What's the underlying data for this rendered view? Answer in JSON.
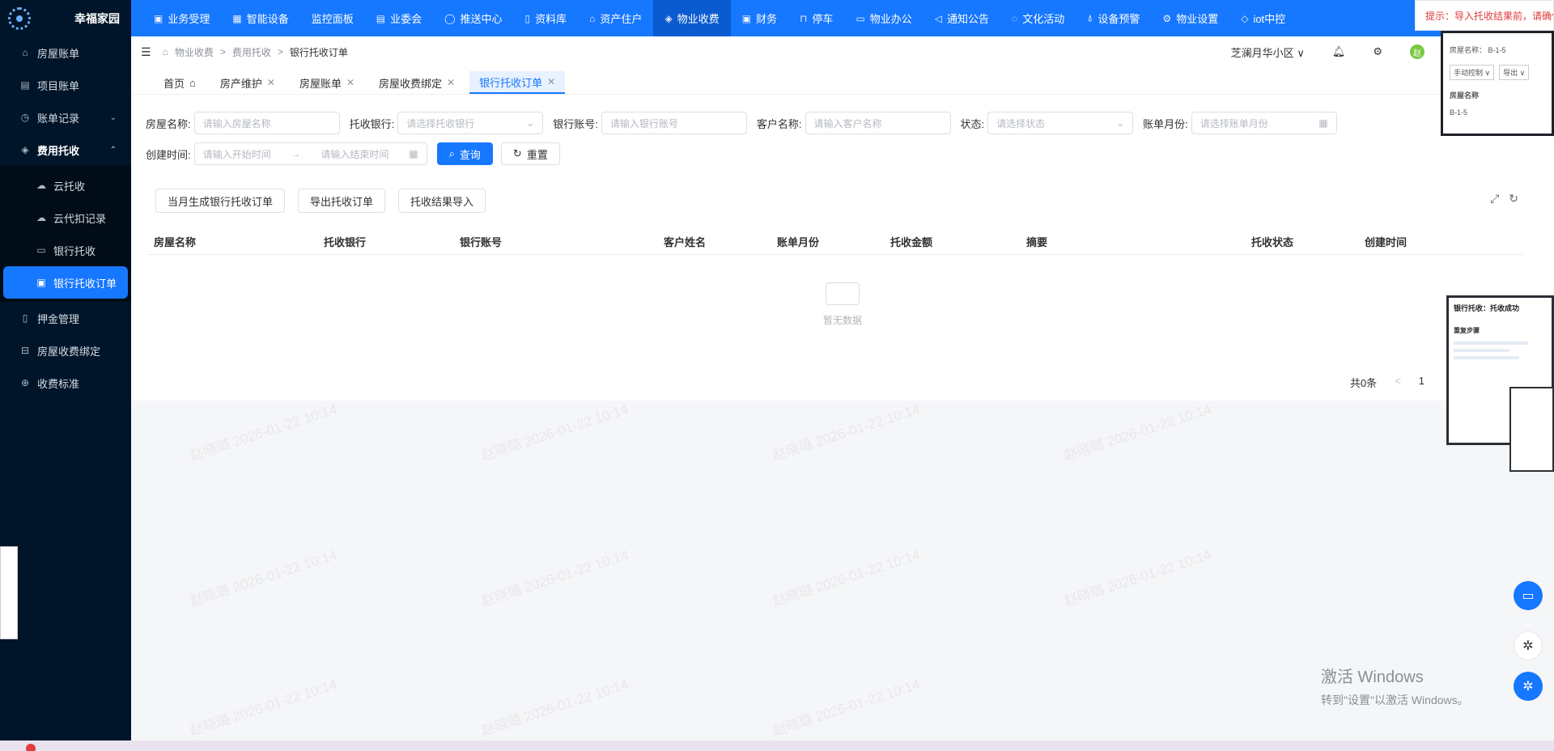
{
  "app": {
    "title": "幸福家园"
  },
  "sidebar": {
    "items": [
      {
        "label": "房屋账单",
        "icon": "home-icon"
      },
      {
        "label": "项目账单",
        "icon": "list-icon"
      },
      {
        "label": "账单记录",
        "icon": "clock-icon",
        "arrow": "⌄"
      },
      {
        "label": "费用托收",
        "icon": "shield-icon",
        "arrow": "⌃"
      }
    ],
    "sub_items": [
      {
        "label": "云托收"
      },
      {
        "label": "云代扣记录"
      },
      {
        "label": "银行托收"
      },
      {
        "label": "银行托收订单"
      }
    ],
    "more_items": [
      {
        "label": "押金管理"
      },
      {
        "label": "房屋收费绑定"
      },
      {
        "label": "收费标准"
      }
    ]
  },
  "topnav": {
    "items": [
      {
        "label": "业务受理"
      },
      {
        "label": "智能设备"
      },
      {
        "label": "监控面板"
      },
      {
        "label": "业委会"
      },
      {
        "label": "推送中心"
      },
      {
        "label": "资料库"
      },
      {
        "label": "资产住户"
      },
      {
        "label": "物业收费"
      },
      {
        "label": "财务"
      },
      {
        "label": "停车"
      },
      {
        "label": "物业办公"
      },
      {
        "label": "通知公告"
      },
      {
        "label": "文化活动"
      },
      {
        "label": "设备预警"
      },
      {
        "label": "物业设置"
      },
      {
        "label": "iot中控"
      }
    ]
  },
  "breadcrumb": {
    "l1": "物业收费",
    "l2": "费用托收",
    "l3": "银行托收订单",
    "sep": ">"
  },
  "header": {
    "community": "芝澜月华小区",
    "avatar_text": "赵"
  },
  "tabs": [
    {
      "label": "首页"
    },
    {
      "label": "房产维护"
    },
    {
      "label": "房屋账单"
    },
    {
      "label": "房屋收费绑定"
    },
    {
      "label": "银行托收订单"
    }
  ],
  "filters": {
    "house_name": {
      "label": "房屋名称:",
      "placeholder": "请输入房屋名称"
    },
    "bank": {
      "label": "托收银行:",
      "placeholder": "请选择托收银行"
    },
    "account": {
      "label": "银行账号:",
      "placeholder": "请输入银行账号"
    },
    "customer": {
      "label": "客户名称:",
      "placeholder": "请输入客户名称"
    },
    "status": {
      "label": "状态:",
      "placeholder": "请选择状态"
    },
    "bill_month": {
      "label": "账单月份:",
      "placeholder": "请选择账单月份"
    },
    "created": {
      "label": "创建时间:",
      "start": "请输入开始时间",
      "end": "请输入结束时间",
      "sep": "→"
    },
    "query_label": "查询",
    "reset_label": "重置"
  },
  "actions": {
    "generate": "当月生成银行托收订单",
    "export": "导出托收订单",
    "import": "托收结果导入"
  },
  "table": {
    "headers": [
      "房屋名称",
      "托收银行",
      "银行账号",
      "客户姓名",
      "账单月份",
      "托收金额",
      "摘要",
      "托收状态",
      "创建时间"
    ],
    "empty_text": "暂无数据"
  },
  "pager": {
    "total": "共0条",
    "prev": "<",
    "page": "1"
  },
  "overlays": {
    "tip": "提示：导入托收结果前，请确保",
    "preview1": {
      "field": "房屋名称：  B-1-5",
      "btn1": "手动控制 ∨",
      "btn2": "导出 ∨",
      "col": "房屋名称",
      "row": "B-1-5"
    },
    "preview2": {
      "title": "银行托收：托收成功",
      "section": "重复步骤"
    }
  },
  "watermark": "赵晓璐 2026-01-22 10:14",
  "windows": {
    "line1": "激活 Windows",
    "line2": "转到\"设置\"以激活 Windows。"
  }
}
